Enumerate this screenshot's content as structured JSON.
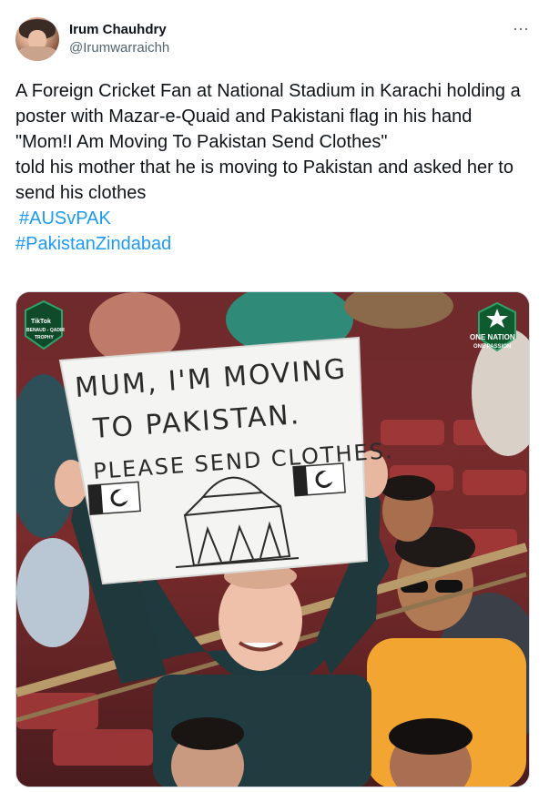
{
  "tweet": {
    "author": {
      "name": "Irum Chauhdry",
      "handle": "@Irumwarraichh"
    },
    "more_label": "···",
    "text_lines": [
      "A Foreign Cricket Fan at National Stadium in Karachi holding a poster with Mazar-e-Quaid and Pakistani flag in his hand",
      "\"Mom!I Am Moving To Pakistan Send Clothes\"",
      "told his mother that he is moving to Pakistan and asked her to send his clothes"
    ],
    "hashtags": [
      "#AUSvPAK",
      "#PakistanZindabad"
    ],
    "media": {
      "sign_lines": [
        "MUM, I'M MOVING",
        "TO PAKISTAN.",
        "PLEASE SEND CLOTHES."
      ],
      "badge_left": {
        "line1": "TikTok",
        "line2": "BENAUD - QADIR",
        "line3": "TROPHY"
      },
      "badge_right": {
        "line1": "ONE NATION",
        "line2": "ONE PASSION"
      }
    },
    "colors": {
      "hashtag": "#1d9bf0",
      "secondary_text": "#536471",
      "primary_text": "#0f1419"
    }
  }
}
